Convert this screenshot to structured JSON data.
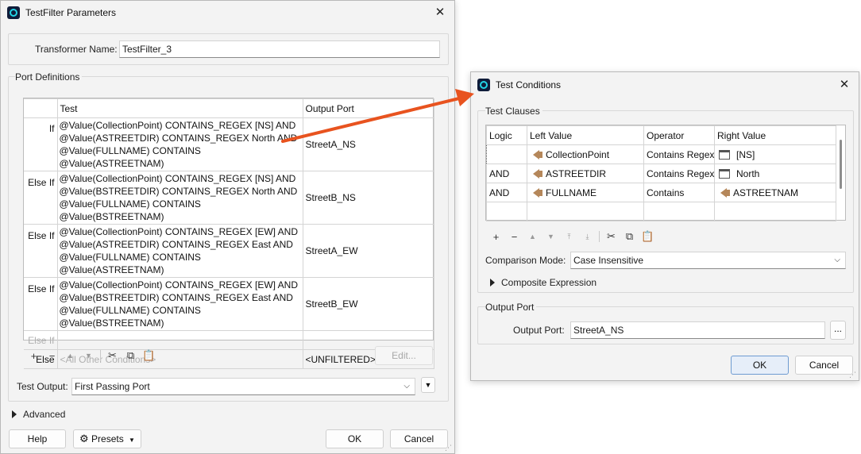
{
  "main": {
    "title": "TestFilter Parameters",
    "transformer_name_label": "Transformer Name:",
    "transformer_name_value": "TestFilter_3",
    "port_definitions_label": "Port Definitions",
    "columns": {
      "test": "Test",
      "output_port": "Output Port"
    },
    "rows": [
      {
        "label": "If",
        "test": "@Value(CollectionPoint) CONTAINS_REGEX [NS] AND @Value(ASTREETDIR) CONTAINS_REGEX North AND @Value(FULLNAME) CONTAINS @Value(ASTREETNAM)",
        "port": "StreetA_NS"
      },
      {
        "label": "Else If",
        "test": "@Value(CollectionPoint) CONTAINS_REGEX [NS] AND @Value(BSTREETDIR) CONTAINS_REGEX North AND @Value(FULLNAME) CONTAINS @Value(BSTREETNAM)",
        "port": "StreetB_NS"
      },
      {
        "label": "Else If",
        "test": "@Value(CollectionPoint) CONTAINS_REGEX [EW] AND @Value(ASTREETDIR) CONTAINS_REGEX East AND @Value(FULLNAME) CONTAINS @Value(ASTREETNAM)",
        "port": "StreetA_EW"
      },
      {
        "label": "Else If",
        "test": "@Value(CollectionPoint) CONTAINS_REGEX [EW] AND @Value(BSTREETDIR) CONTAINS_REGEX East AND @Value(FULLNAME) CONTAINS @Value(BSTREETNAM)",
        "port": "StreetB_EW"
      }
    ],
    "empty_row_label": "Else If",
    "else_row": {
      "label": "Else",
      "test": "<All Other Conditions>",
      "port": "<UNFILTERED>"
    },
    "edit_button": "Edit...",
    "test_output_label": "Test Output:",
    "test_output_value": "First Passing Port",
    "advanced_label": "Advanced",
    "help_button": "Help",
    "presets_button": "Presets",
    "ok_button": "OK",
    "cancel_button": "Cancel"
  },
  "conditions": {
    "title": "Test Conditions",
    "clauses_label": "Test Clauses",
    "columns": {
      "logic": "Logic",
      "left": "Left Value",
      "operator": "Operator",
      "right": "Right Value"
    },
    "rows": [
      {
        "logic": "",
        "left": "CollectionPoint",
        "operator": "Contains Regex",
        "right": "[NS]",
        "right_kind": "value"
      },
      {
        "logic": "AND",
        "left": "ASTREETDIR",
        "operator": "Contains Regex",
        "right": "North",
        "right_kind": "value"
      },
      {
        "logic": "AND",
        "left": "FULLNAME",
        "operator": "Contains",
        "right": "ASTREETNAM",
        "right_kind": "attribute"
      }
    ],
    "comparison_mode_label": "Comparison Mode:",
    "comparison_mode_value": "Case Insensitive",
    "composite_label": "Composite Expression",
    "output_port_group_label": "Output Port",
    "output_port_label": "Output Port:",
    "output_port_value": "StreetA_NS",
    "browse_button": "...",
    "ok_button": "OK",
    "cancel_button": "Cancel"
  },
  "colors": {
    "arrow": "#e8531f",
    "primary_border": "#6e9bd1"
  }
}
